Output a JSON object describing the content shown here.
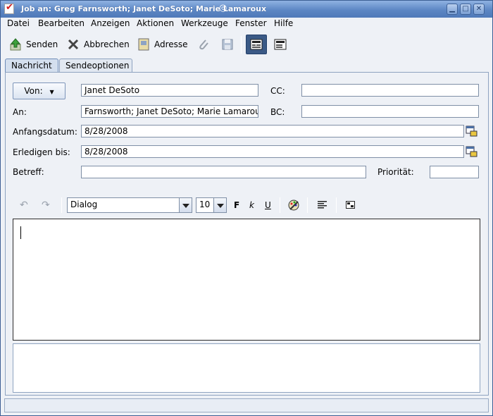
{
  "window": {
    "title": "Job an: Greg Farnsworth; Janet DeSoto; Marie Lamaroux",
    "controls": [
      "minimize",
      "maximize",
      "close"
    ]
  },
  "menu": {
    "items": [
      {
        "label": "Datei"
      },
      {
        "label": "Bearbeiten"
      },
      {
        "label": "Anzeigen"
      },
      {
        "label": "Aktionen"
      },
      {
        "label": "Werkzeuge"
      },
      {
        "label": "Fenster"
      },
      {
        "label": "Hilfe"
      }
    ]
  },
  "toolbar": {
    "send_label": "Senden",
    "cancel_label": "Abbrechen",
    "address_label": "Adresse"
  },
  "tabs": [
    {
      "label": "Nachricht"
    },
    {
      "label": "Sendeoptionen"
    }
  ],
  "form": {
    "von_label": "Von:",
    "von_value": "Janet DeSoto",
    "cc_label": "CC:",
    "cc_value": "",
    "an_label": "An:",
    "an_value": "Farnsworth; Janet DeSoto; Marie Lamaroux",
    "bc_label": "BC:",
    "bc_value": "",
    "start_label": "Anfangsdatum:",
    "start_value": "8/28/2008",
    "due_label": "Erledigen bis:",
    "due_value": "8/28/2008",
    "subject_label": "Betreff:",
    "subject_value": "",
    "priority_label": "Priorität:",
    "priority_value": ""
  },
  "editor_toolbar": {
    "font": "Dialog",
    "size": "10",
    "bold": "F",
    "italic": "k",
    "underline": "U"
  },
  "colors": {
    "titlebar": "#5d87c4",
    "window_bg": "#eef1f6",
    "tab_active": "#d4dfee"
  }
}
